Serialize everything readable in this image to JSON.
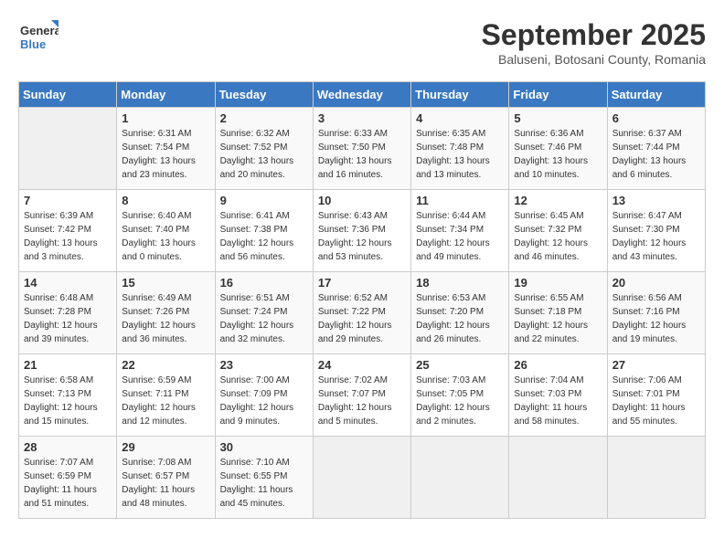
{
  "header": {
    "logo_line1": "General",
    "logo_line2": "Blue",
    "month": "September 2025",
    "location": "Baluseni, Botosani County, Romania"
  },
  "weekdays": [
    "Sunday",
    "Monday",
    "Tuesday",
    "Wednesday",
    "Thursday",
    "Friday",
    "Saturday"
  ],
  "weeks": [
    [
      {
        "day": "",
        "empty": true
      },
      {
        "day": "1",
        "sunrise": "6:31 AM",
        "sunset": "7:54 PM",
        "daylight": "13 hours and 23 minutes."
      },
      {
        "day": "2",
        "sunrise": "6:32 AM",
        "sunset": "7:52 PM",
        "daylight": "13 hours and 20 minutes."
      },
      {
        "day": "3",
        "sunrise": "6:33 AM",
        "sunset": "7:50 PM",
        "daylight": "13 hours and 16 minutes."
      },
      {
        "day": "4",
        "sunrise": "6:35 AM",
        "sunset": "7:48 PM",
        "daylight": "13 hours and 13 minutes."
      },
      {
        "day": "5",
        "sunrise": "6:36 AM",
        "sunset": "7:46 PM",
        "daylight": "13 hours and 10 minutes."
      },
      {
        "day": "6",
        "sunrise": "6:37 AM",
        "sunset": "7:44 PM",
        "daylight": "13 hours and 6 minutes."
      }
    ],
    [
      {
        "day": "7",
        "sunrise": "6:39 AM",
        "sunset": "7:42 PM",
        "daylight": "13 hours and 3 minutes."
      },
      {
        "day": "8",
        "sunrise": "6:40 AM",
        "sunset": "7:40 PM",
        "daylight": "13 hours and 0 minutes."
      },
      {
        "day": "9",
        "sunrise": "6:41 AM",
        "sunset": "7:38 PM",
        "daylight": "12 hours and 56 minutes."
      },
      {
        "day": "10",
        "sunrise": "6:43 AM",
        "sunset": "7:36 PM",
        "daylight": "12 hours and 53 minutes."
      },
      {
        "day": "11",
        "sunrise": "6:44 AM",
        "sunset": "7:34 PM",
        "daylight": "12 hours and 49 minutes."
      },
      {
        "day": "12",
        "sunrise": "6:45 AM",
        "sunset": "7:32 PM",
        "daylight": "12 hours and 46 minutes."
      },
      {
        "day": "13",
        "sunrise": "6:47 AM",
        "sunset": "7:30 PM",
        "daylight": "12 hours and 43 minutes."
      }
    ],
    [
      {
        "day": "14",
        "sunrise": "6:48 AM",
        "sunset": "7:28 PM",
        "daylight": "12 hours and 39 minutes."
      },
      {
        "day": "15",
        "sunrise": "6:49 AM",
        "sunset": "7:26 PM",
        "daylight": "12 hours and 36 minutes."
      },
      {
        "day": "16",
        "sunrise": "6:51 AM",
        "sunset": "7:24 PM",
        "daylight": "12 hours and 32 minutes."
      },
      {
        "day": "17",
        "sunrise": "6:52 AM",
        "sunset": "7:22 PM",
        "daylight": "12 hours and 29 minutes."
      },
      {
        "day": "18",
        "sunrise": "6:53 AM",
        "sunset": "7:20 PM",
        "daylight": "12 hours and 26 minutes."
      },
      {
        "day": "19",
        "sunrise": "6:55 AM",
        "sunset": "7:18 PM",
        "daylight": "12 hours and 22 minutes."
      },
      {
        "day": "20",
        "sunrise": "6:56 AM",
        "sunset": "7:16 PM",
        "daylight": "12 hours and 19 minutes."
      }
    ],
    [
      {
        "day": "21",
        "sunrise": "6:58 AM",
        "sunset": "7:13 PM",
        "daylight": "12 hours and 15 minutes."
      },
      {
        "day": "22",
        "sunrise": "6:59 AM",
        "sunset": "7:11 PM",
        "daylight": "12 hours and 12 minutes."
      },
      {
        "day": "23",
        "sunrise": "7:00 AM",
        "sunset": "7:09 PM",
        "daylight": "12 hours and 9 minutes."
      },
      {
        "day": "24",
        "sunrise": "7:02 AM",
        "sunset": "7:07 PM",
        "daylight": "12 hours and 5 minutes."
      },
      {
        "day": "25",
        "sunrise": "7:03 AM",
        "sunset": "7:05 PM",
        "daylight": "12 hours and 2 minutes."
      },
      {
        "day": "26",
        "sunrise": "7:04 AM",
        "sunset": "7:03 PM",
        "daylight": "11 hours and 58 minutes."
      },
      {
        "day": "27",
        "sunrise": "7:06 AM",
        "sunset": "7:01 PM",
        "daylight": "11 hours and 55 minutes."
      }
    ],
    [
      {
        "day": "28",
        "sunrise": "7:07 AM",
        "sunset": "6:59 PM",
        "daylight": "11 hours and 51 minutes."
      },
      {
        "day": "29",
        "sunrise": "7:08 AM",
        "sunset": "6:57 PM",
        "daylight": "11 hours and 48 minutes."
      },
      {
        "day": "30",
        "sunrise": "7:10 AM",
        "sunset": "6:55 PM",
        "daylight": "11 hours and 45 minutes."
      },
      {
        "day": "",
        "empty": true
      },
      {
        "day": "",
        "empty": true
      },
      {
        "day": "",
        "empty": true
      },
      {
        "day": "",
        "empty": true
      }
    ]
  ],
  "labels": {
    "sunrise": "Sunrise:",
    "sunset": "Sunset:",
    "daylight": "Daylight:"
  }
}
